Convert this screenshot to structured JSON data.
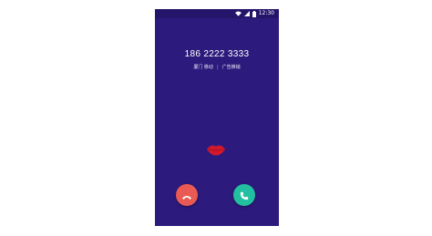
{
  "status_bar": {
    "time": "12:30",
    "icons": [
      "wifi-icon",
      "signal-icon",
      "battery-icon"
    ]
  },
  "call": {
    "number": "186 2222 3333",
    "location": "厦门 移动",
    "separator": "|",
    "tag": "广告推销"
  },
  "colors": {
    "background": "#2d1a7d",
    "decline": "#ea5a54",
    "accept": "#22bfa0",
    "lips": "#d4182c"
  },
  "buttons": {
    "decline_icon": "hang-up-icon",
    "accept_icon": "phone-icon"
  }
}
